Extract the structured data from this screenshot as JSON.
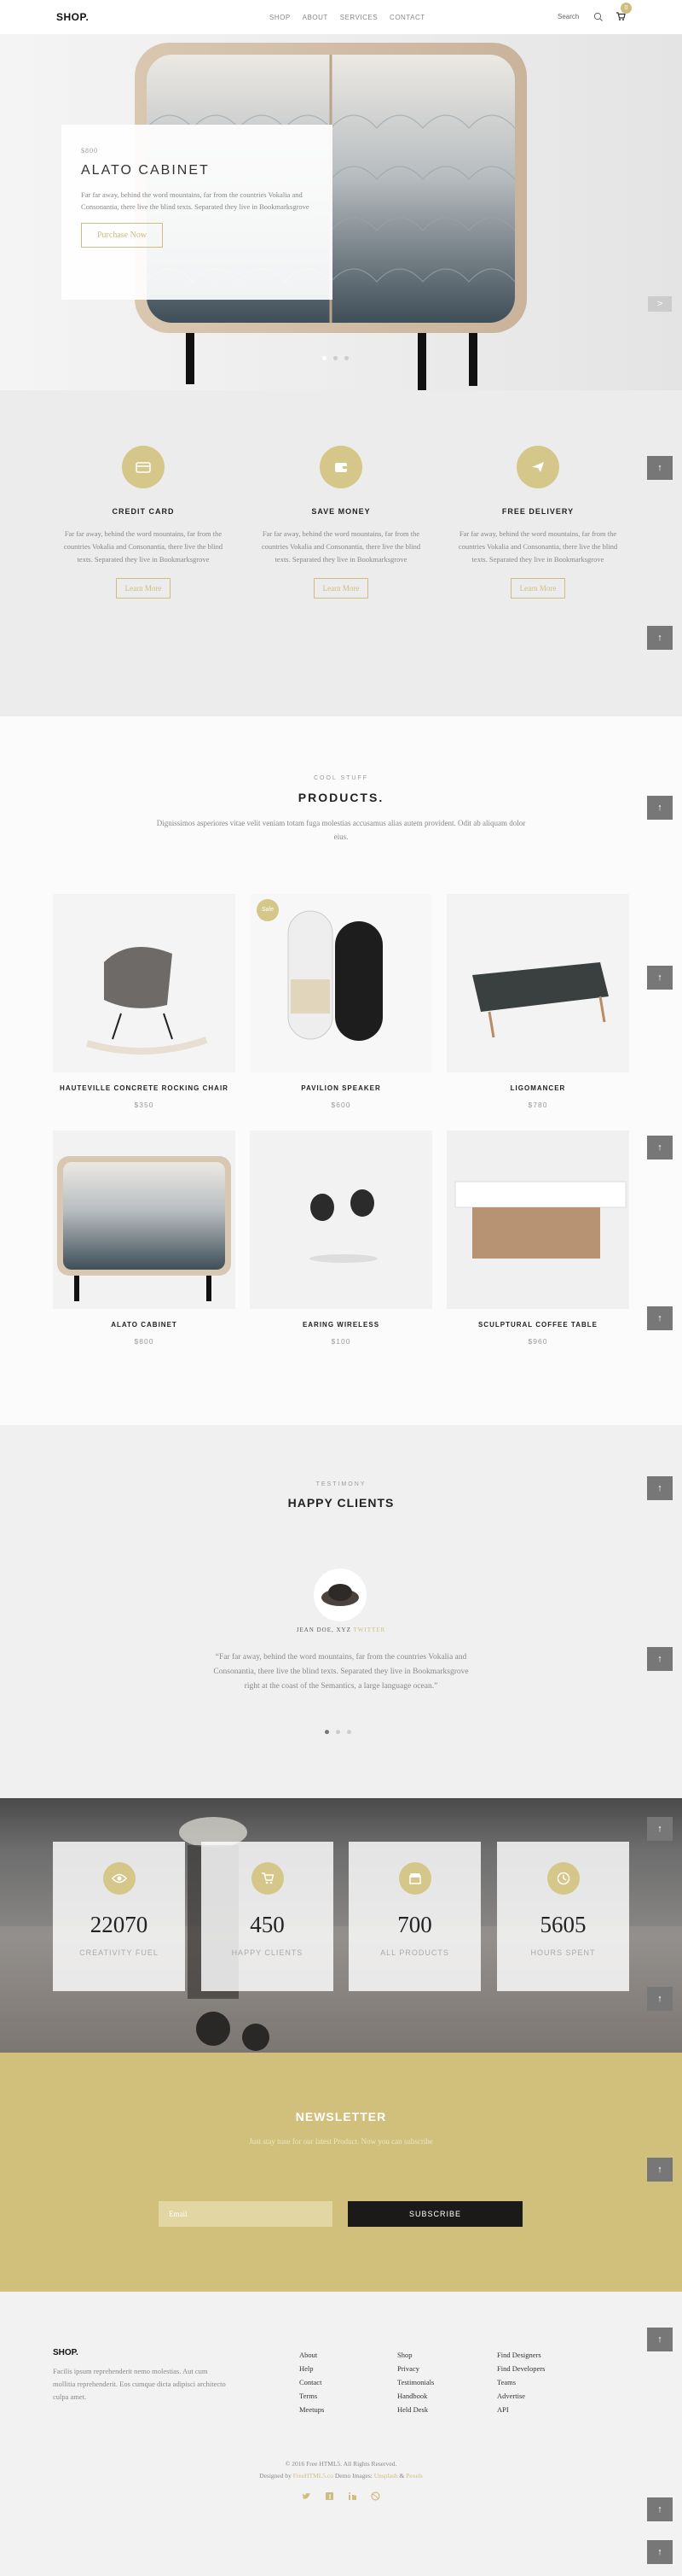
{
  "header": {
    "logo": "SHOP.",
    "nav": [
      "SHOP",
      "ABOUT",
      "SERVICES",
      "CONTACT"
    ],
    "search": "Search",
    "cart_count": "0"
  },
  "hero": {
    "price": "$800",
    "title": "ALATO CABINET",
    "description": "Far far away, behind the word mountains, far from the countries Vokalia and Consonantia, there live the blind texts. Separated they live in Bookmarksgrove",
    "button": "Purchase Now",
    "arrow": ">"
  },
  "features": [
    {
      "icon": "credit-card-icon",
      "title": "CREDIT CARD",
      "text": "Far far away, behind the word mountains, far from the countries Vokalia and Consonantia, there live the blind texts. Separated they live in Bookmarksgrove",
      "button": "Learn More"
    },
    {
      "icon": "wallet-icon",
      "title": "SAVE MONEY",
      "text": "Far far away, behind the word mountains, far from the countries Vokalia and Consonantia, there live the blind texts. Separated they live in Bookmarksgrove",
      "button": "Learn More"
    },
    {
      "icon": "paper-plane-icon",
      "title": "FREE DELIVERY",
      "text": "Far far away, behind the word mountains, far from the countries Vokalia and Consonantia, there live the blind texts. Separated they live in Bookmarksgrove",
      "button": "Learn More"
    }
  ],
  "products": {
    "subtitle": "COOL STUFF",
    "title": "PRODUCTS.",
    "description": "Dignissimos asperiores vitae velit veniam totam fuga molestias accusamus alias autem provident. Odit ab aliquam dolor eius.",
    "items": [
      {
        "name": "HAUTEVILLE CONCRETE ROCKING CHAIR",
        "price": "$350"
      },
      {
        "name": "PAVILION SPEAKER",
        "price": "$600",
        "badge": "Sale"
      },
      {
        "name": "LIGOMANCER",
        "price": "$780"
      },
      {
        "name": "ALATO CABINET",
        "price": "$800"
      },
      {
        "name": "EARING WIRELESS",
        "price": "$100"
      },
      {
        "name": "SCULPTURAL COFFEE TABLE",
        "price": "$960"
      }
    ]
  },
  "testimony": {
    "subtitle": "TESTIMONY",
    "title": "HAPPY CLIENTS",
    "name": "JEAN DOE,",
    "role_prefix": "XYZ",
    "role": "TWITTER",
    "quote": "“Far far away, behind the word mountains, far from the countries Vokalia and Consonantia, there live the blind texts. Separated they live in Bookmarksgrove right at the coast of the Semantics, a large language ocean.”"
  },
  "stats": [
    {
      "icon": "eye-icon",
      "number": "22070",
      "label": "CREATIVITY FUEL"
    },
    {
      "icon": "cart-icon",
      "number": "450",
      "label": "HAPPY CLIENTS"
    },
    {
      "icon": "shop-icon",
      "number": "700",
      "label": "ALL PRODUCTS"
    },
    {
      "icon": "clock-icon",
      "number": "5605",
      "label": "HOURS SPENT"
    }
  ],
  "newsletter": {
    "title": "NEWSLETTER",
    "description": "Just stay tune for our latest Product. Now you can subscribe",
    "placeholder": "Email",
    "button": "SUBSCRIBE"
  },
  "footer": {
    "logo": "SHOP.",
    "description": "Facilis ipsum reprehenderit nemo molestias. Aut cum mollitia reprehenderit. Eos cumque dicta adipisci architecto culpa amet.",
    "col1": [
      "About",
      "Help",
      "Contact",
      "Terms",
      "Meetups"
    ],
    "col2": [
      "Shop",
      "Privacy",
      "Testimonials",
      "Handbook",
      "Held Desk"
    ],
    "col3": [
      "Find Designers",
      "Find Developers",
      "Teams",
      "Advertise",
      "API"
    ],
    "copyright": "© 2016 Free HTML5. All Rights Reserved.",
    "credits_prefix": "Designed by",
    "credits_brand": "FreeHTML5.co",
    "credits_demo": "Demo Images:",
    "credits_img1": "Unsplash",
    "credits_amp": "&",
    "credits_img2": "Pexels"
  },
  "up_arrow": "↑",
  "colors": {
    "accent": "#d0c07c",
    "dark": "#1c1a18"
  }
}
